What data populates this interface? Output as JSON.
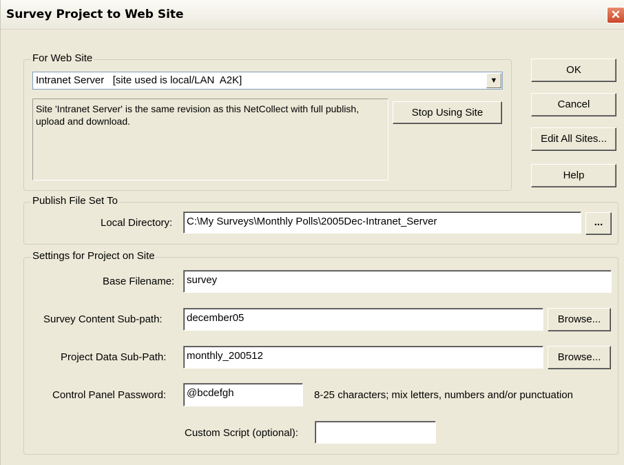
{
  "window": {
    "title": "Survey Project to Web Site",
    "close_glyph": "✕"
  },
  "web_site": {
    "legend": "For Web Site",
    "selected_site": "Intranet Server   [site used is local/LAN  A2K]",
    "info": "Site 'Intranet Server' is the same revision as this NetCollect with full publish, upload and download.",
    "stop_button": "Stop Using Site"
  },
  "side_buttons": {
    "ok": "OK",
    "cancel": "Cancel",
    "edit_all_sites": "Edit All Sites...",
    "help": "Help"
  },
  "publish": {
    "legend": "Publish File Set To",
    "local_dir_label": "Local Directory:",
    "local_dir_value": "C:\\My Surveys\\Monthly Polls\\2005Dec-Intranet_Server",
    "browse_ellipsis": "..."
  },
  "settings": {
    "legend": "Settings for Project on Site",
    "base_filename_label": "Base Filename:",
    "base_filename_value": "survey",
    "content_subpath_label": "Survey Content Sub-path:",
    "content_subpath_value": "december05",
    "data_subpath_label": "Project Data Sub-Path:",
    "data_subpath_value": "monthly_200512",
    "browse_label": "Browse...",
    "password_label": "Control Panel Password:",
    "password_value": "@bcdefgh",
    "password_hint": "8-25 characters; mix letters, numbers and/or punctuation",
    "custom_script_label": "Custom Script (optional):",
    "custom_script_value": ""
  }
}
